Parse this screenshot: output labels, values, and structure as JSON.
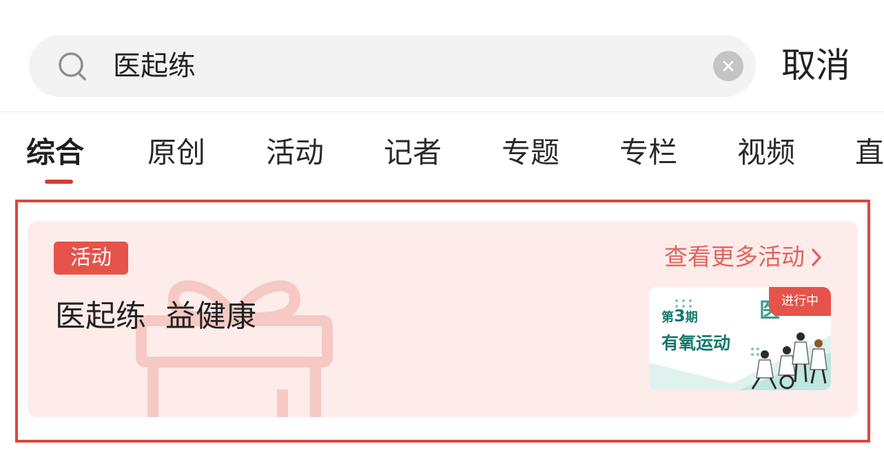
{
  "search": {
    "query": "医起练",
    "cancel_label": "取消"
  },
  "tabs": [
    {
      "label": "综合",
      "active": true
    },
    {
      "label": "原创"
    },
    {
      "label": "活动"
    },
    {
      "label": "记者"
    },
    {
      "label": "专题"
    },
    {
      "label": "专栏"
    },
    {
      "label": "视频"
    },
    {
      "label": "直"
    }
  ],
  "activity_card": {
    "tag": "活动",
    "more_label": "查看更多活动",
    "title": "医起练  益健康",
    "thumbnail": {
      "status": "进行中",
      "issue_prefix": "第",
      "issue_number": "3",
      "issue_suffix": "期",
      "topic": "有氧运动"
    }
  },
  "colors": {
    "accent": "#d43c33",
    "tag_bg": "#e5534b",
    "card_bg": "#fdecea",
    "link": "#e0645c",
    "thumb_teal": "#14786b"
  },
  "icons": {
    "search": "search-icon",
    "clear": "clear-icon",
    "chevron": "chevron-right-icon",
    "gift": "gift-icon"
  }
}
